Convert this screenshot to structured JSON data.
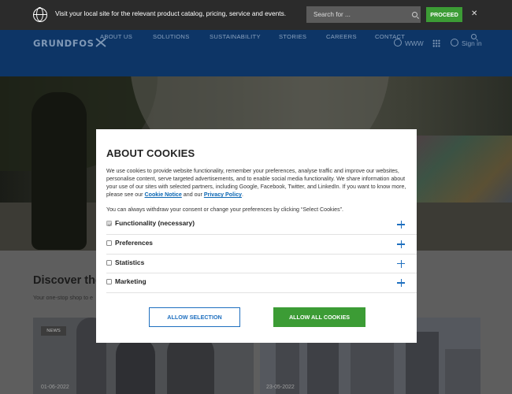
{
  "localbar": {
    "message": "Visit your local site for the relevant product catalog, pricing, service and events.",
    "search_placeholder": "Search for ...",
    "proceed_label": "PROCEED",
    "close_glyph": "✕"
  },
  "header": {
    "logo_text": "GRUNDFOS",
    "www_label": "WWW",
    "signin_label": "Sign in",
    "nav": [
      "ABOUT US",
      "SOLUTIONS",
      "SUSTAINABILITY",
      "STORIES",
      "CAREERS",
      "CONTACT"
    ]
  },
  "discover": {
    "title": "Discover the",
    "subtitle": "Your one-stop shop to e",
    "news_badge": "NEWS",
    "date_left": "01-06-2022",
    "date_right": "23-05-2022"
  },
  "cookie_modal": {
    "title": "ABOUT COOKIES",
    "body_pre": "We use cookies to provide website functionality, remember your preferences, analyse traffic and improve our websites, personalise content, serve targeted advertisements, and to enable social media functionality. We share information about your use of our sites with selected partners, including Google, Facebook, Twitter, and LinkedIn. If you want to know more, please see our ",
    "cookie_notice_link": "Cookie Notice",
    "body_mid": " and our ",
    "privacy_policy_link": "Privacy Policy",
    "body_end": ".",
    "note": "You can always withdraw your consent or change your preferences by clicking “Select Cookies”.",
    "categories": [
      {
        "label": "Functionality (necessary)",
        "checked": true,
        "disabled": true
      },
      {
        "label": "Preferences",
        "checked": false
      },
      {
        "label": "Statistics",
        "checked": false
      },
      {
        "label": "Marketing",
        "checked": false
      }
    ],
    "allow_selection_label": "ALLOW SELECTION",
    "allow_all_label": "ALLOW ALL COOKIES"
  },
  "colors": {
    "brand_blue": "#0d3566",
    "accent_green": "#3c9c35",
    "link_blue": "#0a66b3"
  }
}
